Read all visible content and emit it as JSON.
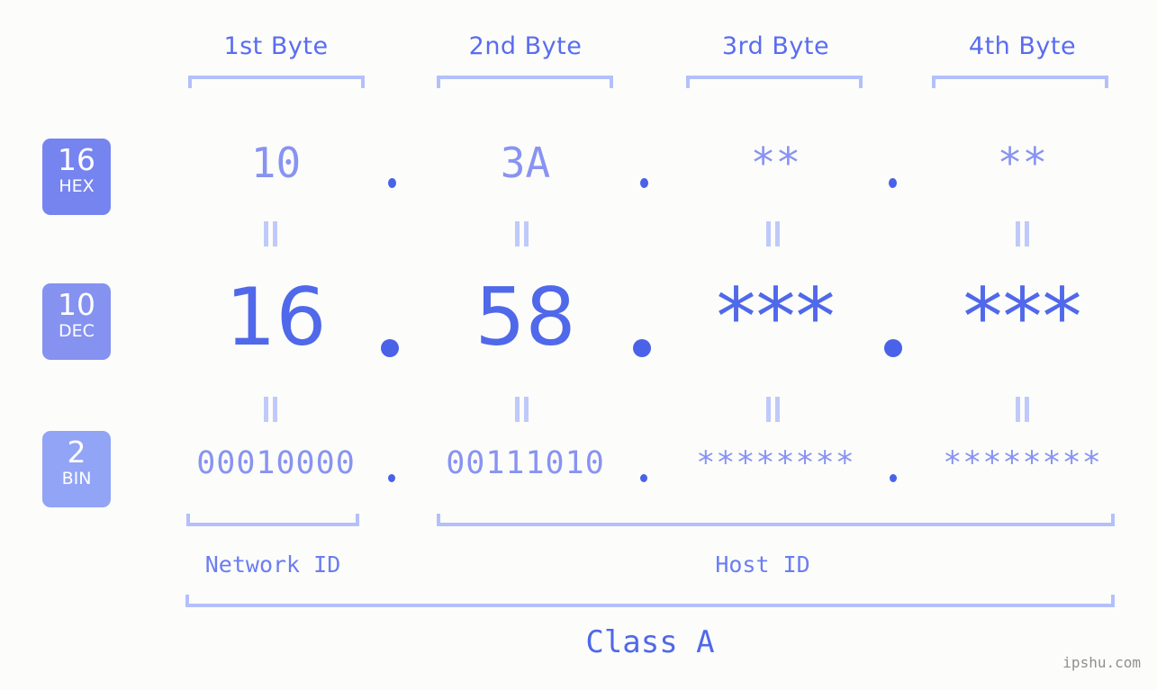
{
  "watermark": "ipshu.com",
  "bases": [
    {
      "key": "hex",
      "number": "16",
      "name": "HEX",
      "color": "#7684f0"
    },
    {
      "key": "dec",
      "number": "10",
      "name": "DEC",
      "color": "#8592f0"
    },
    {
      "key": "bin",
      "number": "2",
      "name": "BIN",
      "color": "#92a4f5"
    }
  ],
  "byte_headers": [
    {
      "label": "1st Byte"
    },
    {
      "label": "2nd Byte"
    },
    {
      "label": "3rd Byte"
    },
    {
      "label": "4th Byte"
    }
  ],
  "rows": {
    "hex": {
      "values": [
        "10",
        "3A",
        "**",
        "**"
      ],
      "separator": "."
    },
    "dec": {
      "values": [
        "16",
        "58",
        "***",
        "***"
      ],
      "separator": "."
    },
    "bin": {
      "values": [
        "00010000",
        "00111010",
        "********",
        "********"
      ],
      "separator": "."
    }
  },
  "equals_symbol": "=",
  "sections": [
    {
      "label": "Network ID"
    },
    {
      "label": "Host ID"
    }
  ],
  "class": {
    "label": "Class A"
  },
  "colors": {
    "background": "#fcfdfa",
    "bracket": "#b4c0fb",
    "header_text": "#5a6cf0",
    "hex_text": "#8893f2",
    "dec_text": "#5068ea",
    "bin_text": "#8893f2",
    "dot": "#4a62e8",
    "equals": "#bfc9fb",
    "section_text": "#6b7df2",
    "watermark_text": "#8f8f8f"
  }
}
